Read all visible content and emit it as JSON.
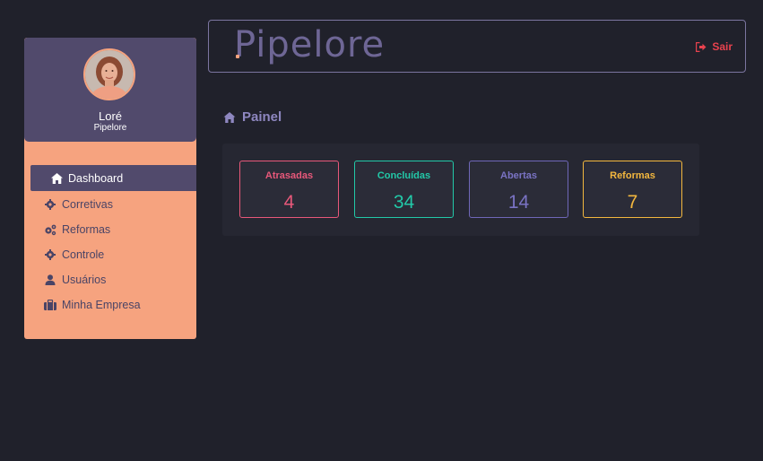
{
  "sidebar": {
    "profile": {
      "name": "Loré",
      "organization": "Pipelore"
    },
    "items": [
      {
        "label": "Dashboard",
        "icon": "home-icon",
        "active": true
      },
      {
        "label": "Corretivas",
        "icon": "gear-icon",
        "active": false
      },
      {
        "label": "Reformas",
        "icon": "gears-icon",
        "active": false
      },
      {
        "label": "Controle",
        "icon": "gear-icon",
        "active": false
      },
      {
        "label": "Usuários",
        "icon": "user-icon",
        "active": false
      },
      {
        "label": "Minha Empresa",
        "icon": "briefcase-icon",
        "active": false
      }
    ]
  },
  "header": {
    "logo_text": "Pipelore",
    "logout_label": "Sair"
  },
  "main": {
    "title": "Painel",
    "stats": [
      {
        "label": "Atrasadas",
        "value": "4",
        "color": "#e8587a"
      },
      {
        "label": "Concluídas",
        "value": "34",
        "color": "#22c9a8"
      },
      {
        "label": "Abertas",
        "value": "14",
        "color": "#6f67b8"
      },
      {
        "label": "Reformas",
        "value": "7",
        "color": "#f3b73e"
      }
    ]
  },
  "colors": {
    "background": "#20212b",
    "sidebar": "#f6a37f",
    "sidebar_header": "#514a6c",
    "logout": "#e8424e"
  }
}
